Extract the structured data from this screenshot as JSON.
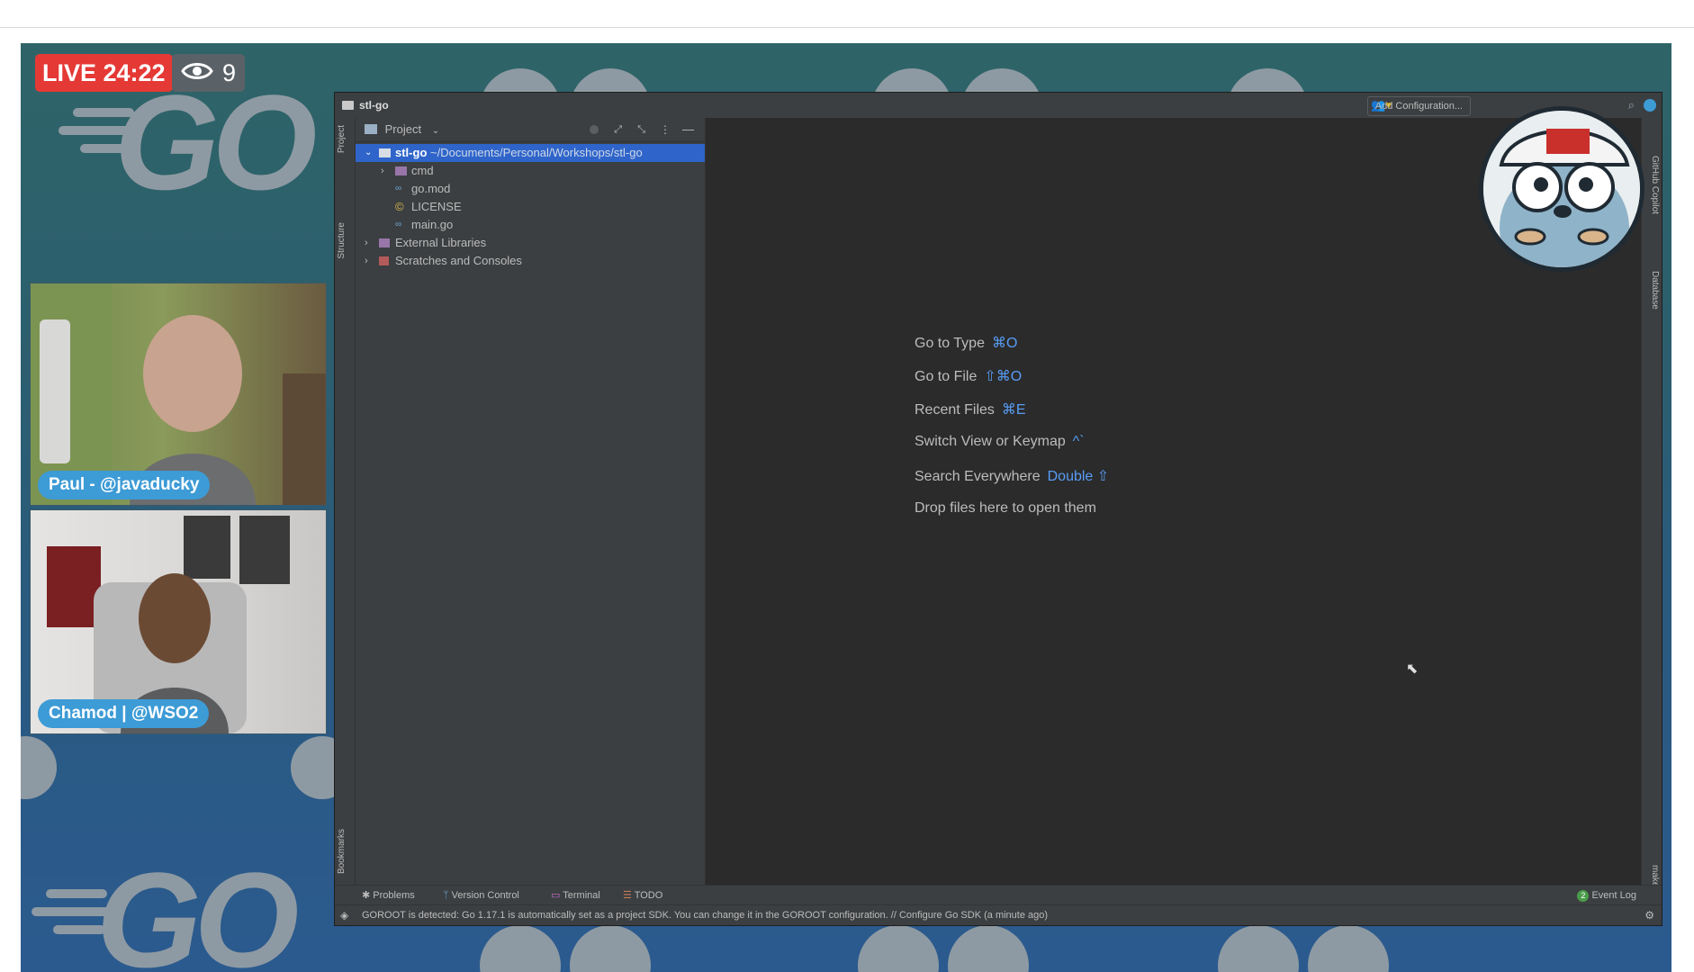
{
  "live": {
    "label": "LIVE 24:22",
    "viewers": "9"
  },
  "participants": [
    {
      "name": "Paul - @javaducky"
    },
    {
      "name": "Chamod | @WSO2"
    }
  ],
  "ide": {
    "project_name": "stl-go",
    "add_configuration": "Add Configuration...",
    "project_panel": {
      "title": "Project"
    },
    "left_tabs": [
      "Project",
      "Structure",
      "Bookmarks"
    ],
    "right_tabs": [
      "GitHub Copilot",
      "Database",
      "make"
    ],
    "tree": {
      "root_name": "stl-go",
      "root_path": "~/Documents/Personal/Workshops/stl-go",
      "items": [
        "cmd",
        "go.mod",
        "LICENSE",
        "main.go"
      ],
      "external_libraries": "External Libraries",
      "scratches": "Scratches and Consoles"
    },
    "hints": [
      {
        "label": "Go to Type",
        "key": "⌘O"
      },
      {
        "label": "Go to File",
        "key": "⇧⌘O"
      },
      {
        "label": "Recent Files",
        "key": "⌘E"
      },
      {
        "label": "Switch View or Keymap",
        "key": "^`"
      },
      {
        "label": "Search Everywhere",
        "key": "Double ⇧"
      },
      {
        "label": "Drop files here to open them",
        "key": ""
      }
    ],
    "bottom_tabs": [
      "Problems",
      "Version Control",
      "Terminal",
      "TODO"
    ],
    "event_log_count": "2",
    "event_log": "Event Log",
    "status_message": "GOROOT is detected: Go 1.17.1 is automatically set as a project SDK. You can change it in the GOROOT configuration. // Configure Go SDK (a minute ago)"
  },
  "colors": {
    "live_red": "#e53935",
    "ide_bg": "#2b2b2b",
    "selection": "#2f65ca",
    "accent_blue": "#589df6",
    "name_tag": "#3d9bd6"
  }
}
